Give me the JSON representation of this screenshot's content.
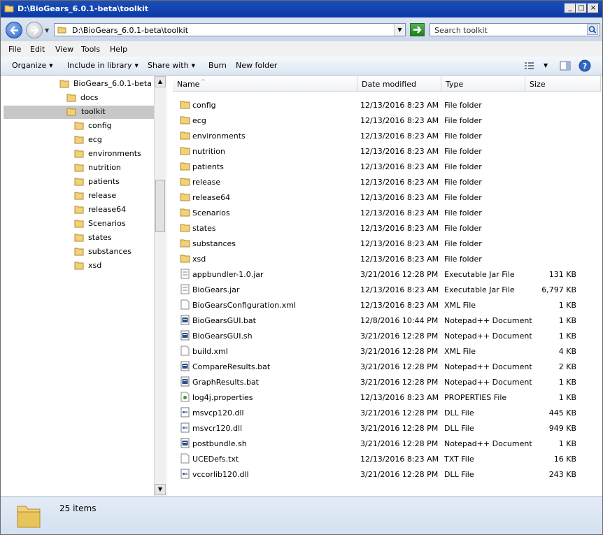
{
  "window": {
    "title": "D:\\BioGears_6.0.1-beta\\toolkit",
    "buttons": {
      "minimize": "_",
      "maximize": "□",
      "close": "×"
    }
  },
  "address": {
    "path": "D:\\BioGears_6.0.1-beta\\toolkit",
    "search_placeholder": "Search toolkit"
  },
  "menu": [
    "File",
    "Edit",
    "View",
    "Tools",
    "Help"
  ],
  "commands": {
    "organize": "Organize",
    "include": "Include in library",
    "share": "Share with",
    "burn": "Burn",
    "newfolder": "New folder"
  },
  "tree": {
    "root": "BioGears_6.0.1-beta",
    "docs": "docs",
    "selected": "toolkit",
    "children": [
      "config",
      "ecg",
      "environments",
      "nutrition",
      "patients",
      "release",
      "release64",
      "Scenarios",
      "states",
      "substances",
      "xsd"
    ]
  },
  "columns": {
    "name": "Name",
    "date": "Date modified",
    "type": "Type",
    "size": "Size"
  },
  "files": [
    {
      "name": "config",
      "date": "12/13/2016 8:23 AM",
      "type": "File folder",
      "size": "",
      "icon": "folder"
    },
    {
      "name": "ecg",
      "date": "12/13/2016 8:23 AM",
      "type": "File folder",
      "size": "",
      "icon": "folder"
    },
    {
      "name": "environments",
      "date": "12/13/2016 8:23 AM",
      "type": "File folder",
      "size": "",
      "icon": "folder"
    },
    {
      "name": "nutrition",
      "date": "12/13/2016 8:23 AM",
      "type": "File folder",
      "size": "",
      "icon": "folder"
    },
    {
      "name": "patients",
      "date": "12/13/2016 8:23 AM",
      "type": "File folder",
      "size": "",
      "icon": "folder"
    },
    {
      "name": "release",
      "date": "12/13/2016 8:23 AM",
      "type": "File folder",
      "size": "",
      "icon": "folder"
    },
    {
      "name": "release64",
      "date": "12/13/2016 8:23 AM",
      "type": "File folder",
      "size": "",
      "icon": "folder"
    },
    {
      "name": "Scenarios",
      "date": "12/13/2016 8:23 AM",
      "type": "File folder",
      "size": "",
      "icon": "folder"
    },
    {
      "name": "states",
      "date": "12/13/2016 8:23 AM",
      "type": "File folder",
      "size": "",
      "icon": "folder"
    },
    {
      "name": "substances",
      "date": "12/13/2016 8:23 AM",
      "type": "File folder",
      "size": "",
      "icon": "folder"
    },
    {
      "name": "xsd",
      "date": "12/13/2016 8:23 AM",
      "type": "File folder",
      "size": "",
      "icon": "folder"
    },
    {
      "name": "appbundler-1.0.jar",
      "date": "3/21/2016 12:28 PM",
      "type": "Executable Jar File",
      "size": "131 KB",
      "icon": "jar"
    },
    {
      "name": "BioGears.jar",
      "date": "12/13/2016 8:23 AM",
      "type": "Executable Jar File",
      "size": "6,797 KB",
      "icon": "jar"
    },
    {
      "name": "BioGearsConfiguration.xml",
      "date": "12/13/2016 8:23 AM",
      "type": "XML File",
      "size": "1 KB",
      "icon": "file"
    },
    {
      "name": "BioGearsGUI.bat",
      "date": "12/8/2016 10:44 PM",
      "type": "Notepad++ Document",
      "size": "1 KB",
      "icon": "bat"
    },
    {
      "name": "BioGearsGUI.sh",
      "date": "3/21/2016 12:28 PM",
      "type": "Notepad++ Document",
      "size": "1 KB",
      "icon": "bat"
    },
    {
      "name": "build.xml",
      "date": "3/21/2016 12:28 PM",
      "type": "XML File",
      "size": "4 KB",
      "icon": "file"
    },
    {
      "name": "CompareResults.bat",
      "date": "3/21/2016 12:28 PM",
      "type": "Notepad++ Document",
      "size": "2 KB",
      "icon": "bat"
    },
    {
      "name": "GraphResults.bat",
      "date": "3/21/2016 12:28 PM",
      "type": "Notepad++ Document",
      "size": "1 KB",
      "icon": "bat"
    },
    {
      "name": "log4j.properties",
      "date": "12/13/2016 8:23 AM",
      "type": "PROPERTIES File",
      "size": "1 KB",
      "icon": "props"
    },
    {
      "name": "msvcp120.dll",
      "date": "3/21/2016 12:28 PM",
      "type": "DLL File",
      "size": "445 KB",
      "icon": "dll"
    },
    {
      "name": "msvcr120.dll",
      "date": "3/21/2016 12:28 PM",
      "type": "DLL File",
      "size": "949 KB",
      "icon": "dll"
    },
    {
      "name": "postbundle.sh",
      "date": "3/21/2016 12:28 PM",
      "type": "Notepad++ Document",
      "size": "1 KB",
      "icon": "bat"
    },
    {
      "name": "UCEDefs.txt",
      "date": "12/13/2016 8:23 AM",
      "type": "TXT File",
      "size": "16 KB",
      "icon": "file"
    },
    {
      "name": "vccorlib120.dll",
      "date": "3/21/2016 12:28 PM",
      "type": "DLL File",
      "size": "243 KB",
      "icon": "dll"
    }
  ],
  "status": {
    "count": "25 items"
  },
  "colors": {
    "title_bar": "#0b3aa8",
    "folder": "#e8c55a",
    "selection": "#c7c7c7"
  }
}
